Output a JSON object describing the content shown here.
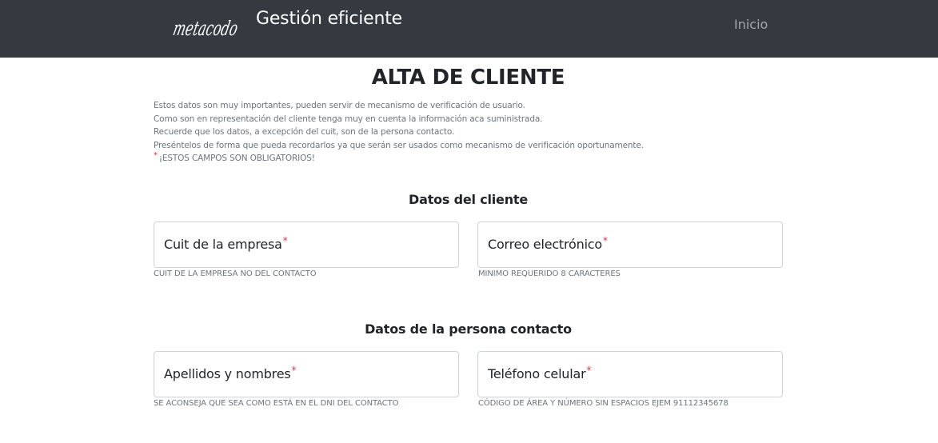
{
  "navbar": {
    "logo_text": "metacodo",
    "brand": "Gestión eficiente",
    "nav_inicio": "Inicio"
  },
  "page": {
    "title": "ALTA DE CLIENTE",
    "intro": [
      "Estos datos son muy importantes, pueden servir de mecanismo de verificación de usuario.",
      "Como son en representación del cliente tenga muy en cuenta la información aca suministrada.",
      "Recuerde que los datos, a excepción del cuit, son de la persona contacto.",
      "Preséntelos de forma que pueda recordarlos ya que serán ser usados como mecanismo de verificación oportunamente."
    ],
    "required_star": "*",
    "required_note": "¡ESTOS CAMPOS SON OBLIGATORIOS!"
  },
  "sections": {
    "cliente": {
      "title": "Datos del cliente",
      "cuit": {
        "label": "Cuit de la empresa",
        "help": "CUIT DE LA EMPRESA NO DEL CONTACTO",
        "value": ""
      },
      "email": {
        "label": "Correo electrónico",
        "help": "MINIMO REQUERIDO 8 CARACTERES",
        "value": ""
      }
    },
    "contacto": {
      "title": "Datos de la persona contacto",
      "nombre": {
        "label": "Apellidos y nombres",
        "help": "SE ACONSEJA QUE SEA COMO ESTÁ EN EL DNI DEL CONTACTO",
        "value": ""
      },
      "telefono": {
        "label": "Teléfono celular",
        "help": "CÓDIGO DE ÁREA Y NÚMERO SIN ESPACIOS EJEM 91112345678",
        "value": ""
      }
    }
  },
  "colors": {
    "navbar_bg": "#343a40",
    "required": "#dc3545",
    "muted": "#6c757d"
  }
}
